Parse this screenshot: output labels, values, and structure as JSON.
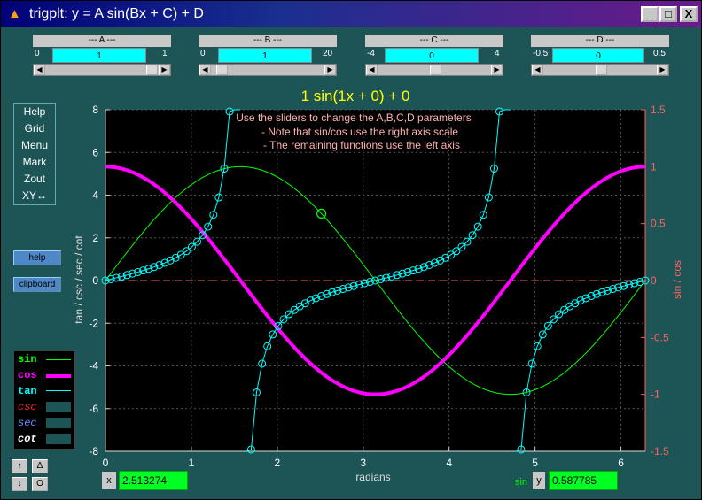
{
  "window": {
    "title": "trigplt: y = A sin(Bx + C) + D",
    "buttons": [
      "_",
      "□",
      "X"
    ]
  },
  "sliders": [
    {
      "title": "--- A ---",
      "min": "0",
      "max": "1",
      "value": "1"
    },
    {
      "title": "--- B ---",
      "min": "0",
      "max": "20",
      "value": "1"
    },
    {
      "title": "--- C ---",
      "min": "-4",
      "max": "4",
      "value": "0"
    },
    {
      "title": "--- D ---",
      "min": "-0.5",
      "max": "0.5",
      "value": "0"
    }
  ],
  "menu": [
    "Help",
    "Grid",
    "Menu",
    "Mark",
    "Zout",
    "XY↔"
  ],
  "side_buttons": {
    "help": "help",
    "clipboard": "clipboard"
  },
  "legend": [
    {
      "label": "sin",
      "color": "#00ff00"
    },
    {
      "label": "cos",
      "color": "#ff00ff"
    },
    {
      "label": "tan",
      "color": "#00ffff"
    },
    {
      "label": "csc",
      "color": "#ff2020"
    },
    {
      "label": "sec",
      "color": "#6a8cff"
    },
    {
      "label": "cot",
      "color": "#ffffff"
    }
  ],
  "nav_buttons": [
    "↑",
    "Δ",
    "↓",
    "O"
  ],
  "readouts": {
    "x_label": "x",
    "x_value": "2.513274",
    "func_label": "sin",
    "y_label": "y",
    "y_value": "0.587785"
  },
  "chart_data": {
    "type": "line",
    "title": "1 sin(1x + 0) + 0",
    "xlabel": "radians",
    "ylabel_left": "tan / csc / sec / cot",
    "ylabel_right": "sin / cos",
    "xlim": [
      0,
      6.283185
    ],
    "ylim_left": [
      -8,
      8
    ],
    "ylim_right": [
      -1.5,
      1.5
    ],
    "x_ticks": [
      "0",
      "1",
      "2",
      "3",
      "4",
      "5",
      "6"
    ],
    "y_ticks_left": [
      "-8",
      "-6",
      "-4",
      "-2",
      "0",
      "2",
      "4",
      "6",
      "8"
    ],
    "y_ticks_right": [
      "-1.5",
      "-1",
      "-0.5",
      "0",
      "0.5",
      "1",
      "1.5"
    ],
    "grid": true,
    "annotations": [
      "Use the sliders to change the A,B,C,D parameters",
      "- Note that sin/cos use the right axis scale",
      "- The remaining functions use the left axis"
    ],
    "series": [
      {
        "name": "sin",
        "axis": "right",
        "function": "sin(x)",
        "color": "#00ff00"
      },
      {
        "name": "cos",
        "axis": "right",
        "function": "cos(x)",
        "color": "#ff00ff"
      },
      {
        "name": "tan",
        "axis": "left",
        "function": "tan(x)",
        "color": "#00ffff",
        "markers": "circle"
      }
    ],
    "marker_point": {
      "x": 2.513274,
      "y": 0.587785,
      "series": "sin"
    },
    "zero_line": {
      "axis": "right",
      "y": 0,
      "color": "#ff6060"
    }
  }
}
